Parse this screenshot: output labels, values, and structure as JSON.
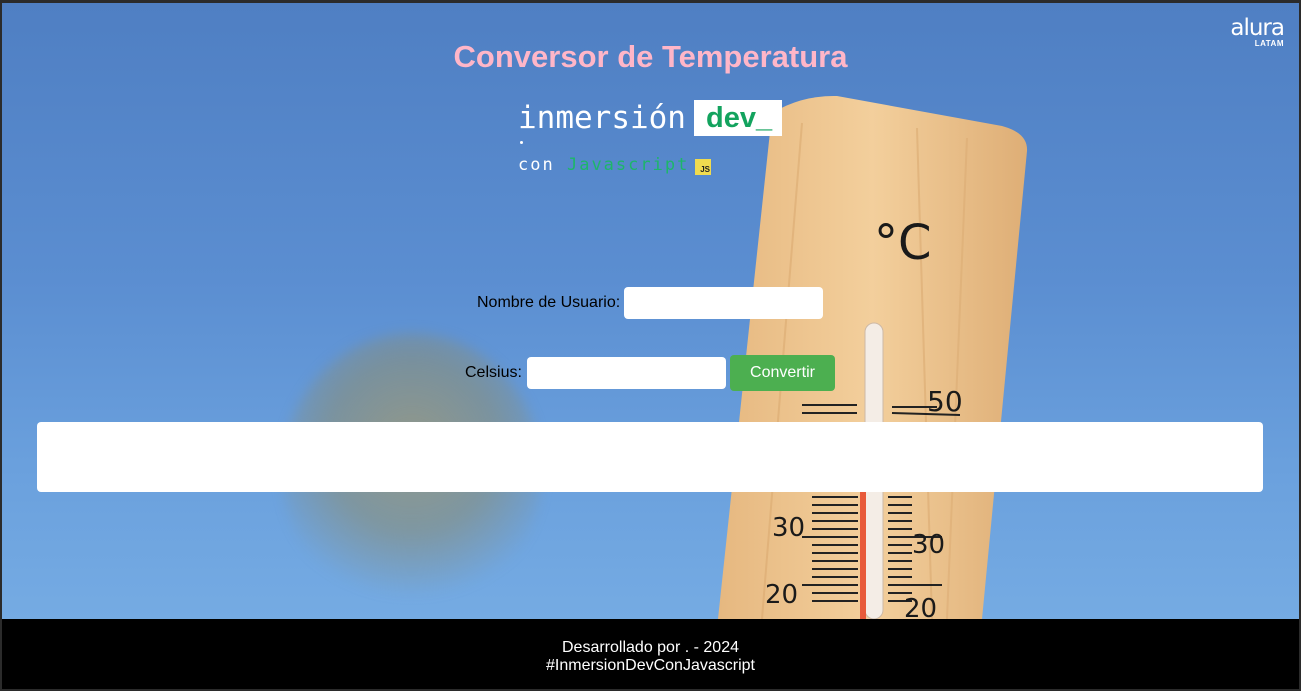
{
  "app": {
    "title": "Conversor de Temperatura"
  },
  "brand": {
    "logo_word": "alura",
    "logo_sub": "LATAM",
    "immersion_word": "inmersión",
    "immersion_dev": "dev_",
    "immersion_con": "con",
    "immersion_js": "Javascript",
    "js_badge": "JS"
  },
  "thermometer": {
    "unit_mark": "°C",
    "scale_labels": [
      "50",
      "30",
      "30",
      "20",
      "20"
    ]
  },
  "form": {
    "username_label": "Nombre de Usuario:",
    "username_value": "",
    "celsius_label": "Celsius:",
    "celsius_value": "",
    "convert_label": "Convertir"
  },
  "result": {
    "text": ""
  },
  "footer": {
    "credit": "Desarrollado por . - 2024",
    "hashtag": "#InmersionDevConJavascript"
  },
  "colors": {
    "title": "#ffb6c8",
    "button": "#4caf50",
    "dev_green": "#13a35e",
    "footer_bg": "#000000"
  }
}
